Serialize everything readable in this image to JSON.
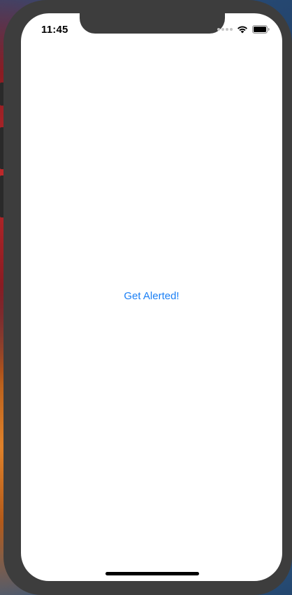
{
  "status_bar": {
    "time": "11:45",
    "signal_icon": "signal-dots-icon",
    "wifi_icon": "wifi-icon",
    "battery_icon": "battery-icon"
  },
  "main": {
    "alert_button_label": "Get Alerted!"
  },
  "colors": {
    "accent": "#1a7ff5",
    "frame": "#3d3d3d",
    "screen_bg": "#ffffff"
  }
}
